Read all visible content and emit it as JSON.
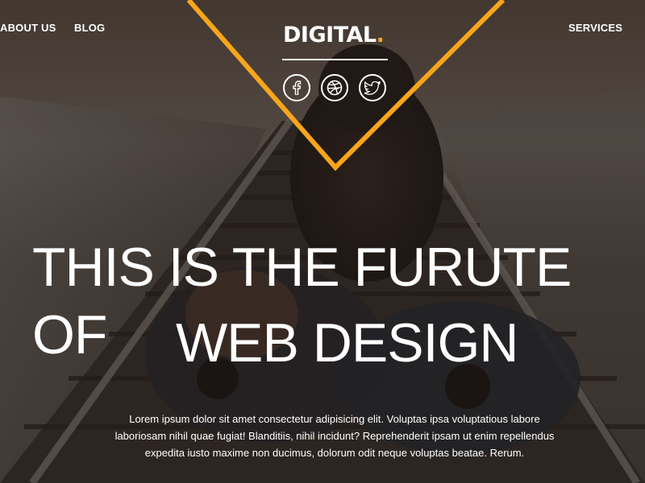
{
  "nav": {
    "left_items": [
      "ABOUT US",
      "BLOG"
    ],
    "right_items": [
      "SERVICES"
    ]
  },
  "logo": {
    "text": "DIGITAL",
    "dot": "."
  },
  "social": [
    {
      "icon": "facebook-icon",
      "glyph": "f"
    },
    {
      "icon": "dribbble-icon"
    },
    {
      "icon": "twitter-icon"
    }
  ],
  "hero": {
    "headline_line1": "THIS IS THE FURUTE OF",
    "headline_line2": "WEB DESIGN",
    "lead": "Lorem ipsum dolor sit amet consectetur adipisicing elit. Voluptas ipsa voluptatious labore laboriosam nihil quae fugiat! Blanditiis, nihil incidunt? Reprehenderit ipsam ut enim repellendus expedita iusto maxime non ducimus, dolorum odit neque voluptas beatae. Rerum."
  },
  "colors": {
    "accent": "#f7a51c",
    "text": "#ffffff",
    "overlay": "#1e1916"
  }
}
